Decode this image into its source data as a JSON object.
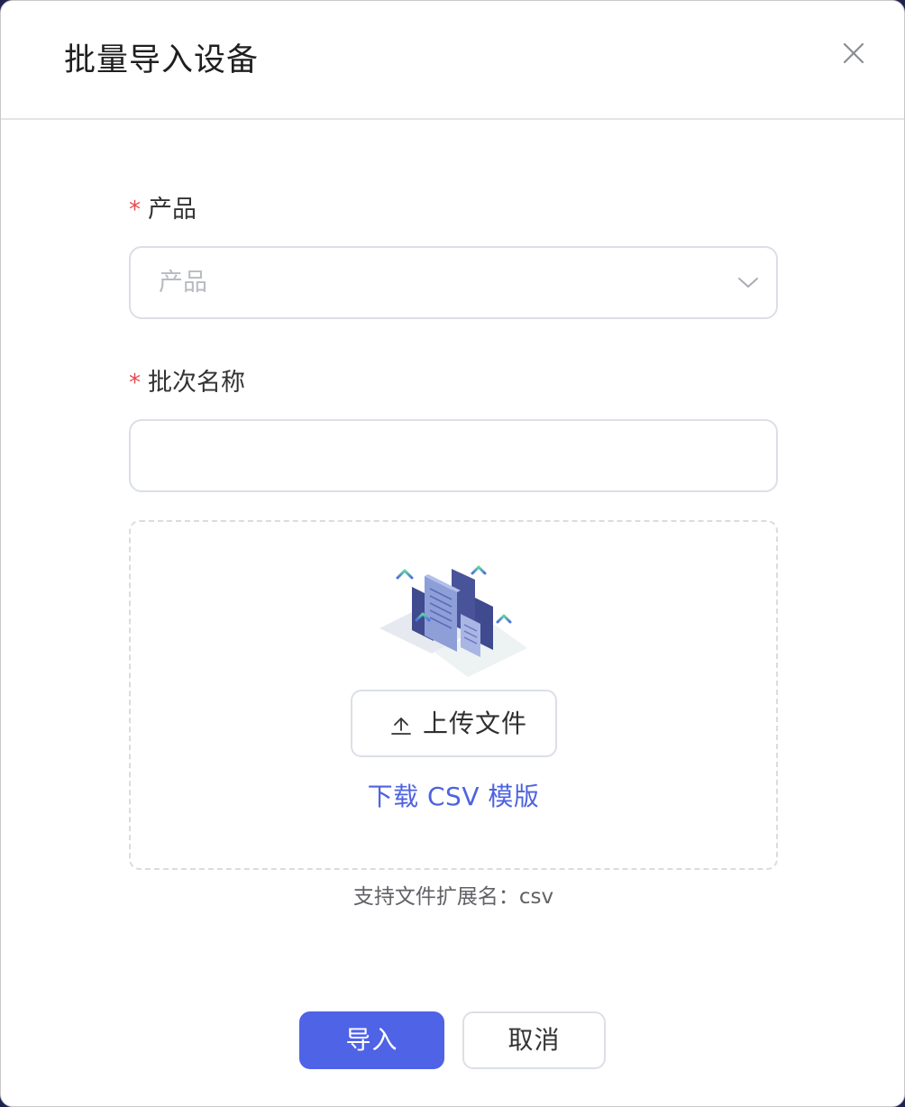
{
  "modal": {
    "title": "批量导入设备",
    "close_icon": "close-icon"
  },
  "form": {
    "required_mark": "*",
    "product": {
      "label": "产品",
      "placeholder": "产品",
      "value": ""
    },
    "batch_name": {
      "label": "批次名称",
      "value": "",
      "placeholder": ""
    }
  },
  "upload": {
    "illustration_icon": "upload-files-illustration",
    "button_icon": "upload-icon",
    "button_label": "上传文件",
    "template_link": "下载 CSV 模版",
    "support_text": "支持文件扩展名：csv"
  },
  "footer": {
    "confirm_label": "导入",
    "cancel_label": "取消"
  },
  "colors": {
    "primary": "#4f63e7",
    "link": "#4d63e0",
    "required": "#e5484d",
    "border": "#dcdfe6"
  }
}
